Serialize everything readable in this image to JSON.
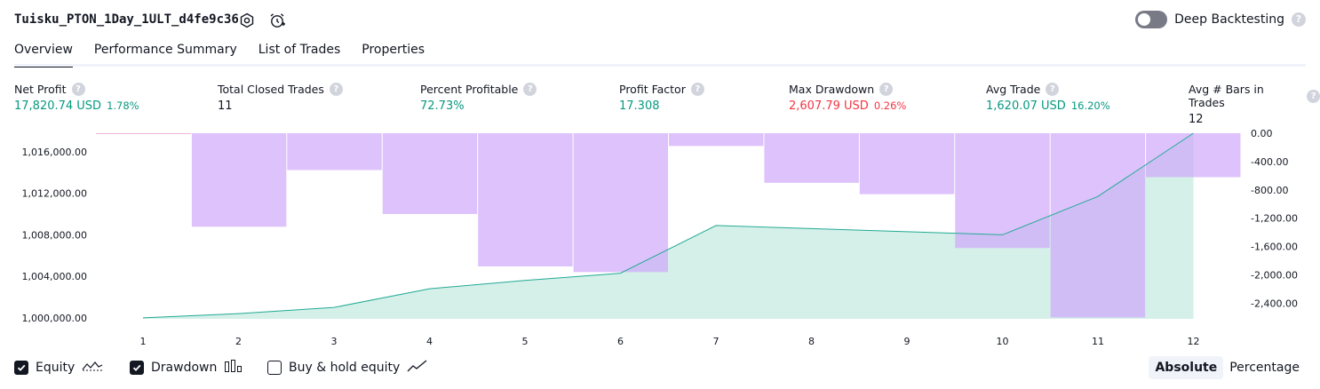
{
  "header": {
    "title": "Tuisku_PTON_1Day_1ULT_d4fe9c36",
    "deep_backtesting_label": "Deep Backtesting",
    "help_glyph": "?"
  },
  "tabs": [
    "Overview",
    "Performance Summary",
    "List of Trades",
    "Properties"
  ],
  "stats": [
    {
      "label": "Net Profit",
      "value": "17,820.74 USD",
      "pct": "1.78%",
      "color": "green"
    },
    {
      "label": "Total Closed Trades",
      "value": "11",
      "pct": "",
      "color": "default"
    },
    {
      "label": "Percent Profitable",
      "value": "72.73%",
      "pct": "",
      "color": "green"
    },
    {
      "label": "Profit Factor",
      "value": "17.308",
      "pct": "",
      "color": "green"
    },
    {
      "label": "Max Drawdown",
      "value": "2,607.79 USD",
      "pct": "0.26%",
      "color": "red"
    },
    {
      "label": "Avg Trade",
      "value": "1,620.07 USD",
      "pct": "16.20%",
      "color": "green"
    },
    {
      "label": "Avg # Bars in Trades",
      "value": "12",
      "pct": "",
      "color": "default"
    }
  ],
  "chart_data": {
    "type": "line",
    "x": [
      1,
      2,
      3,
      4,
      5,
      6,
      7,
      8,
      9,
      10,
      11,
      12
    ],
    "series": [
      {
        "name": "Equity",
        "values": [
          1000000,
          1000400,
          1001000,
          1002800,
          1003600,
          1004300,
          1008900,
          1008600,
          1008300,
          1008000,
          1011700,
          1017800
        ]
      },
      {
        "name": "Drawdown",
        "values": [
          0,
          -1320,
          -520,
          -1140,
          -1880,
          -1960,
          -180,
          -700,
          -860,
          -1620,
          -2600,
          -620
        ]
      }
    ],
    "left_ticks": [
      "1,000,000.00",
      "1,004,000.00",
      "1,008,000.00",
      "1,012,000.00",
      "1,016,000.00"
    ],
    "right_ticks": [
      "0.00",
      "-400.00",
      "-800.00",
      "-1,200.00",
      "-1,600.00",
      "-2,000.00",
      "-2,400.00"
    ],
    "equity_ylim": [
      999900,
      1017800
    ],
    "drawdown_ylim": [
      -2620,
      0
    ],
    "colors": {
      "equity_line": "#22ab94",
      "equity_fill": "#d5efe9",
      "drawdown_bar": "#cfa8fb",
      "drawdown_alpha": 0.7
    }
  },
  "legend": {
    "equity": "Equity",
    "drawdown": "Drawdown",
    "buy_hold": "Buy & hold equity"
  },
  "view_toggle": {
    "absolute": "Absolute",
    "percentage": "Percentage"
  }
}
